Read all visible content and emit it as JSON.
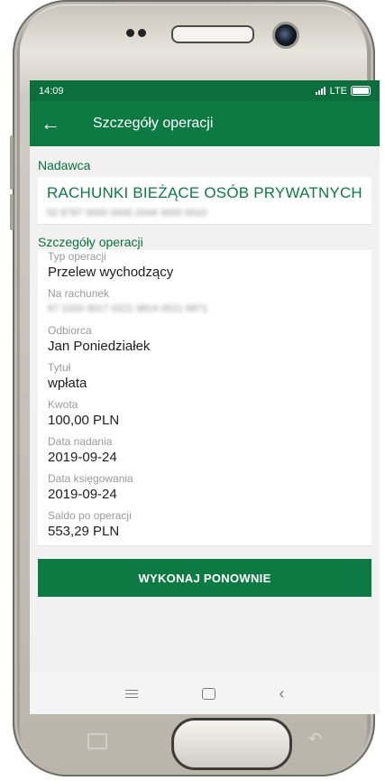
{
  "status_bar": {
    "time": "14:09",
    "network": "LTE"
  },
  "app_bar": {
    "title": "Szczegóły operacji",
    "back_icon": "arrow-left-icon"
  },
  "sender": {
    "section_label": "Nadawca",
    "name": "RACHUNKI BIEŻĄCE OSÓB PRYWATNYCH",
    "account_number": "52 8787 0000 0000 2044 3000 0010"
  },
  "details": {
    "section_label": "Szczegóły operacji",
    "fields": [
      {
        "label": "Typ operacji",
        "value": "Przelew wychodzący"
      },
      {
        "label": "Na rachunek",
        "value": "67 1020 3017 0221 9814 0521 6871"
      },
      {
        "label": "Odbiorca",
        "value": "Jan Poniedziałek"
      },
      {
        "label": "Tytuł",
        "value": "wpłata"
      },
      {
        "label": "Kwota",
        "value": "100,00 PLN"
      },
      {
        "label": "Data nadania",
        "value": "2019-09-24"
      },
      {
        "label": "Data księgowania",
        "value": "2019-09-24"
      },
      {
        "label": "Saldo po operacji",
        "value": "553,29 PLN"
      }
    ]
  },
  "action": {
    "label": "WYKONAJ PONOWNIE"
  },
  "colors": {
    "brand_green": "#0d7a44",
    "status_green": "#0a6f3c"
  }
}
